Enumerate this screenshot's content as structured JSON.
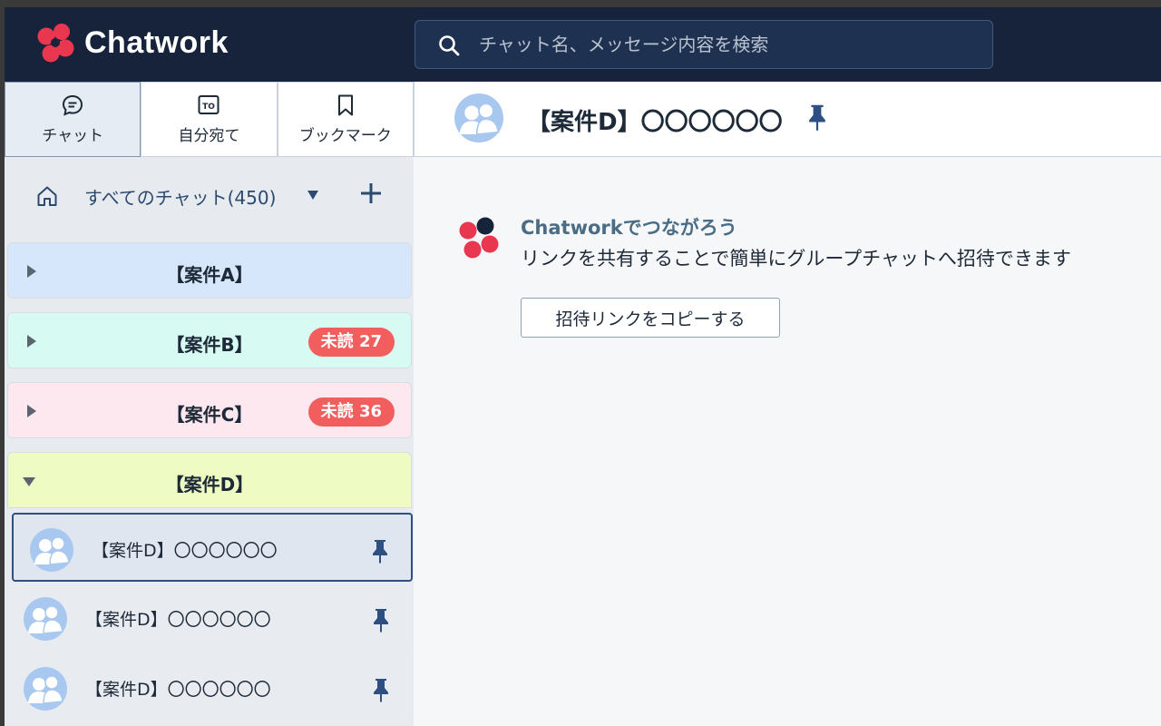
{
  "header": {
    "brand": "Chatwork",
    "search_placeholder": "チャット名、メッセージ内容を検索"
  },
  "tabs": [
    {
      "label": "チャット",
      "icon": "chat-bubble-icon",
      "active": true
    },
    {
      "label": "自分宛て",
      "icon": "to-icon",
      "active": false
    },
    {
      "label": "ブックマーク",
      "icon": "bookmark-icon",
      "active": false
    }
  ],
  "sidebar": {
    "filter_label": "すべてのチャット(450)",
    "categories": [
      {
        "name": "【案件A】",
        "bg": "#d6e7fb",
        "expanded": false,
        "badge": ""
      },
      {
        "name": "【案件B】",
        "bg": "#d7fbf3",
        "expanded": false,
        "badge": "未読 27"
      },
      {
        "name": "【案件C】",
        "bg": "#fde8ef",
        "expanded": false,
        "badge": "未読 36"
      },
      {
        "name": "【案件D】",
        "bg": "#eefcc4",
        "expanded": true,
        "badge": ""
      }
    ],
    "rooms": [
      {
        "name": "【案件D】〇〇〇〇〇〇",
        "pinned": true,
        "selected": true
      },
      {
        "name": "【案件D】〇〇〇〇〇〇",
        "pinned": true,
        "selected": false
      },
      {
        "name": "【案件D】〇〇〇〇〇〇",
        "pinned": true,
        "selected": false
      }
    ]
  },
  "room_header": {
    "title": "【案件D】〇〇〇〇〇〇",
    "pinned": true
  },
  "invite": {
    "title": "Chatworkでつながろう",
    "description": "リンクを共有することで簡単にグループチャットへ招待できます",
    "button_label": "招待リンクをコピーする"
  },
  "colors": {
    "topbar": "#16233a",
    "badge": "#f25e5e",
    "accent": "#2e4f82",
    "logo_red": "#e8374f",
    "logo_dark": "#16233a"
  }
}
